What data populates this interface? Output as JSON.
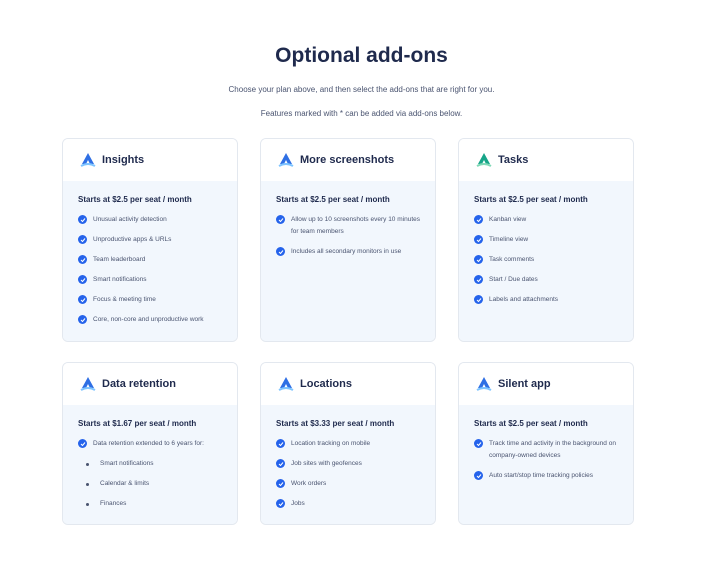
{
  "header": {
    "title": "Optional add-ons",
    "subtitle": "Choose your plan above, and then select the add-ons that are right for you.",
    "note": "Features marked with * can be added via add-ons below."
  },
  "colors": {
    "accent": "#2563eb",
    "card_body": "#f2f7fd",
    "border": "#e3e8ef"
  },
  "cards": [
    {
      "title": "Insights",
      "icon": "insights-logo-icon",
      "price": "Starts at $2.5 per seat / month",
      "features": [
        "Unusual activity detection",
        "Unproductive apps & URLs",
        "Team leaderboard",
        "Smart notifications",
        "Focus & meeting time",
        "Core, non-core and unproductive work"
      ]
    },
    {
      "title": "More screenshots",
      "icon": "screenshots-logo-icon",
      "price": "Starts at $2.5 per seat / month",
      "features": [
        "Allow up to 10 screenshots every 10 minutes for team members",
        "Includes all secondary monitors in use"
      ]
    },
    {
      "title": "Tasks",
      "icon": "tasks-logo-icon",
      "price": "Starts at $2.5 per seat / month",
      "features": [
        "Kanban view",
        "Timeline view",
        "Task comments",
        "Start / Due dates",
        "Labels and attachments"
      ]
    },
    {
      "title": "Data retention",
      "icon": "data-retention-logo-icon",
      "price": "Starts at $1.67 per seat / month",
      "features": [
        "Data retention extended to 6 years for:"
      ],
      "sub_features": [
        "Smart notifications",
        "Calendar & limits",
        "Finances"
      ]
    },
    {
      "title": "Locations",
      "icon": "locations-logo-icon",
      "price": "Starts at $3.33 per seat / month",
      "features": [
        "Location tracking on mobile",
        "Job sites with geofences",
        "Work orders",
        "Jobs"
      ]
    },
    {
      "title": "Silent app",
      "icon": "silent-app-logo-icon",
      "price": "Starts at $2.5 per seat / month",
      "features": [
        "Track time and activity in the background on company-owned devices",
        "Auto start/stop time tracking policies"
      ]
    }
  ]
}
